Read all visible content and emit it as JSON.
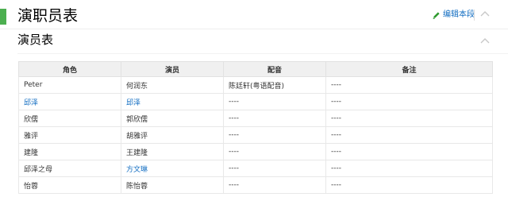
{
  "section": {
    "title": "演职员表",
    "edit_label": "编辑本段"
  },
  "subsection": {
    "title": "演员表"
  },
  "table": {
    "headers": [
      "角色",
      "演员",
      "配音",
      "备注"
    ],
    "rows": [
      {
        "cells": [
          "Peter",
          "何润东",
          "陈廷轩(粤语配音)",
          "----"
        ],
        "links": [
          false,
          false,
          false,
          false
        ]
      },
      {
        "cells": [
          "邱泽",
          "邱泽",
          "----",
          "----"
        ],
        "links": [
          true,
          true,
          false,
          false
        ]
      },
      {
        "cells": [
          "欣儒",
          "郭欣儒",
          "----",
          "----"
        ],
        "links": [
          false,
          false,
          false,
          false
        ]
      },
      {
        "cells": [
          "雅评",
          "胡雅评",
          "----",
          "----"
        ],
        "links": [
          false,
          false,
          false,
          false
        ]
      },
      {
        "cells": [
          "建隆",
          "王建隆",
          "----",
          "----"
        ],
        "links": [
          false,
          false,
          false,
          false
        ]
      },
      {
        "cells": [
          "邱泽之母",
          "方文琳",
          "----",
          "----"
        ],
        "links": [
          false,
          true,
          false,
          false
        ]
      },
      {
        "cells": [
          "怡蓉",
          "陈怡蓉",
          "----",
          "----"
        ],
        "links": [
          false,
          false,
          false,
          false
        ]
      }
    ]
  },
  "colors": {
    "accent_bar": "#4caf50",
    "link": "#136ec2",
    "header_bg": "#f0f0f0"
  },
  "icons": {
    "edit": "pencil-icon",
    "collapse": "chevron-up-icon"
  }
}
